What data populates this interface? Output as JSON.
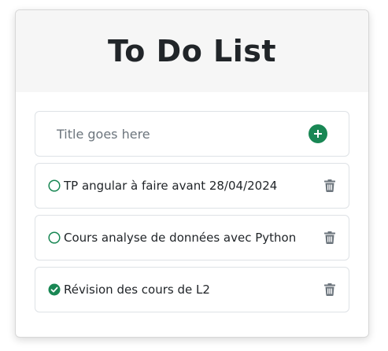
{
  "header": {
    "title": "To Do List"
  },
  "new_task": {
    "placeholder": "Title goes here",
    "value": "",
    "add_icon": "plus-circle-icon"
  },
  "tasks": [
    {
      "label": "TP angular à faire avant 28/04/2024",
      "done": false,
      "delete_icon": "trash-icon"
    },
    {
      "label": "Cours analyse de données avec Python",
      "done": false,
      "delete_icon": "trash-icon"
    },
    {
      "label": "Révision des cours de L2",
      "done": true,
      "delete_icon": "trash-icon"
    }
  ],
  "colors": {
    "accent_green": "#198754",
    "trash_gray": "#6c757d",
    "header_bg": "#f6f6f6"
  }
}
